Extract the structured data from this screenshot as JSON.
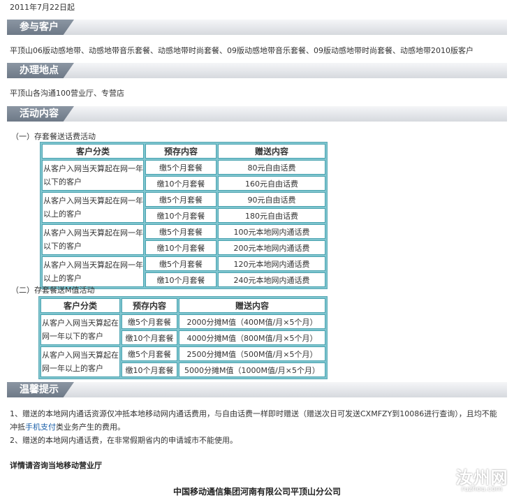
{
  "date": "2011年7月22日起",
  "sections": {
    "customers": {
      "title": "参与客户",
      "text": "平顶山06版动感地带、动感地带音乐套餐、动感地带时尚套餐、09版动感地带音乐套餐、09版动感地带时尚套餐、动感地带2010版客户"
    },
    "locations": {
      "title": "办理地点",
      "text": "平顶山各沟通100营业厅、专营店"
    },
    "activity": {
      "title": "活动内容"
    },
    "tips": {
      "title": "温馨提示"
    }
  },
  "activity1": {
    "title": "（一）存套餐送话费活动",
    "headers": [
      "客户分类",
      "预存内容",
      "赠送内容"
    ],
    "groups": [
      {
        "category": "从客户入网当天算起在网一年以下的客户",
        "rows": [
          [
            "缴5个月套餐",
            "80元自由话费"
          ],
          [
            "缴10个月套餐",
            "160元自由话费"
          ]
        ]
      },
      {
        "category": "从客户入网当天算起在网一年以上的客户",
        "rows": [
          [
            "缴5个月套餐",
            "90元自由话费"
          ],
          [
            "缴10个月套餐",
            "180元自由话费"
          ]
        ]
      },
      {
        "category": "从客户入网当天算起在网一年以下的客户",
        "rows": [
          [
            "缴5个月套餐",
            "100元本地网内通话费"
          ],
          [
            "缴10个月套餐",
            "200元本地网内通话费"
          ]
        ]
      },
      {
        "category": "从客户入网当天算起在网一年以上的客户",
        "rows": [
          [
            "缴5个月套餐",
            "120元本地网内通话费"
          ],
          [
            "缴10个月套餐",
            "240元本地网内通话费"
          ]
        ]
      }
    ]
  },
  "activity2": {
    "title": "（二）存套餐送M值活动",
    "headers": [
      "客户分类",
      "预存内容",
      "赠送内容"
    ],
    "groups": [
      {
        "category": "从客户入网当天算起在网一年以下的客户",
        "rows": [
          [
            "缴5个月套餐",
            "2000分摊M值（400M值/月×5个月）"
          ],
          [
            "缴10个月套餐",
            "4000分摊M值（800M值/月×5个月）"
          ]
        ]
      },
      {
        "category": "从客户入网当天算起在网一年以上的客户",
        "rows": [
          [
            "缴5个月套餐",
            "2500分摊M值（500M值/月×5个月）"
          ],
          [
            "缴10个月套餐",
            "5000分摊M值（1000M值/月×5个月）"
          ]
        ]
      }
    ]
  },
  "notes": {
    "n1_a": "1、赠送的本地网内通话资源仅冲抵本地移动网内通话费用，与自由话费一样即时赠送（赠送次日可发送CXMFZY到10086进行查询），且均不能冲抵",
    "n1_link": "手机支付",
    "n1_b": "类业务产生的费用。",
    "n2": "2、赠送的本地网内通话费，在非常假期省内的申请城市不能使用。"
  },
  "consult": "详情请咨询当地移动营业厅",
  "footer": "中国移动通信集团河南有限公司平顶山分公司",
  "watermark": {
    "name": "汝州网",
    "domain": "ruzhou.com"
  }
}
